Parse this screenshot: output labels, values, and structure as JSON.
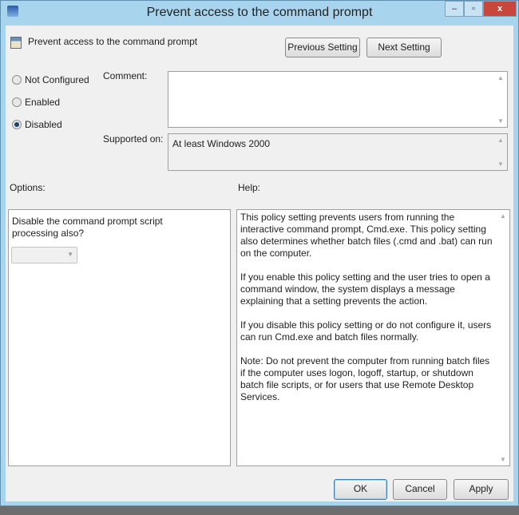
{
  "window": {
    "title": "Prevent access to the command prompt",
    "controls": {
      "minimize": "–",
      "maximize": "▫",
      "close": "x"
    }
  },
  "header": {
    "setting_name": "Prevent access to the command prompt",
    "previous_label": "Previous Setting",
    "next_label": "Next Setting"
  },
  "state": {
    "options": [
      "Not Configured",
      "Enabled",
      "Disabled"
    ],
    "selected": "Disabled"
  },
  "comment": {
    "label": "Comment:",
    "value": ""
  },
  "supported": {
    "label": "Supported on:",
    "value": "At least Windows 2000"
  },
  "options_panel": {
    "label": "Options:",
    "text": "Disable the command prompt script processing also?",
    "dropdown_value": ""
  },
  "help_panel": {
    "label": "Help:",
    "paragraphs": [
      "This policy setting prevents users from running the interactive command prompt, Cmd.exe.  This policy setting also determines whether batch files (.cmd and .bat) can run on the computer.",
      "If you enable this policy setting and the user tries to open a command window, the system displays a message explaining that a setting prevents the action.",
      "If you disable this policy setting or do not configure it, users can run Cmd.exe and batch files normally.",
      "Note: Do not prevent the computer from running batch files if the computer uses logon, logoff, startup, or shutdown batch file scripts, or for users that use Remote Desktop Services."
    ]
  },
  "footer": {
    "ok": "OK",
    "cancel": "Cancel",
    "apply": "Apply"
  }
}
